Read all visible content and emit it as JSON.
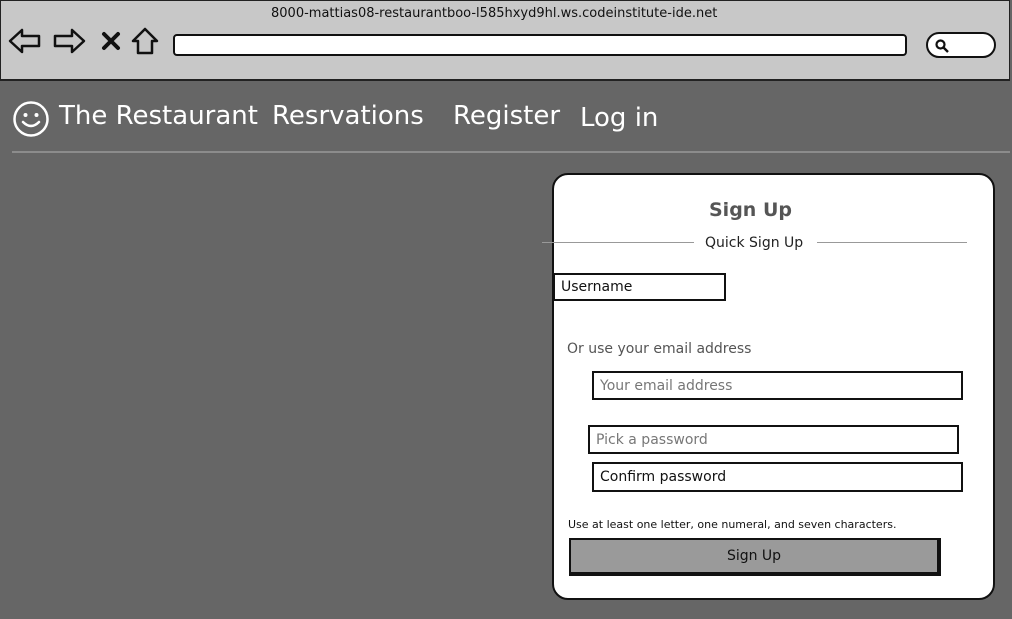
{
  "browser": {
    "url": "8000-mattias08-restaurantboo-l585hxyd9hl.ws.codeinstitute-ide.net",
    "icons": [
      "back-arrow-icon",
      "forward-arrow-icon",
      "close-icon",
      "home-icon",
      "search-icon"
    ]
  },
  "nav": {
    "brand": "The Restaurant",
    "links": [
      "Resrvations",
      "Register",
      "Log in"
    ]
  },
  "signup": {
    "title": "Sign Up",
    "subtitle": "Quick Sign Up",
    "username_value": "Username",
    "or_email": "Or use your email address",
    "email_placeholder": "Your email address",
    "password_placeholder": "Pick a password",
    "confirm_value": "Confirm password",
    "hint": "Use at least one letter, one numeral, and seven characters.",
    "submit_label": "Sign Up"
  },
  "colors": {
    "page_background": "#666666",
    "chrome_background": "#c8c8c8",
    "button_background": "#9a9a9a"
  }
}
